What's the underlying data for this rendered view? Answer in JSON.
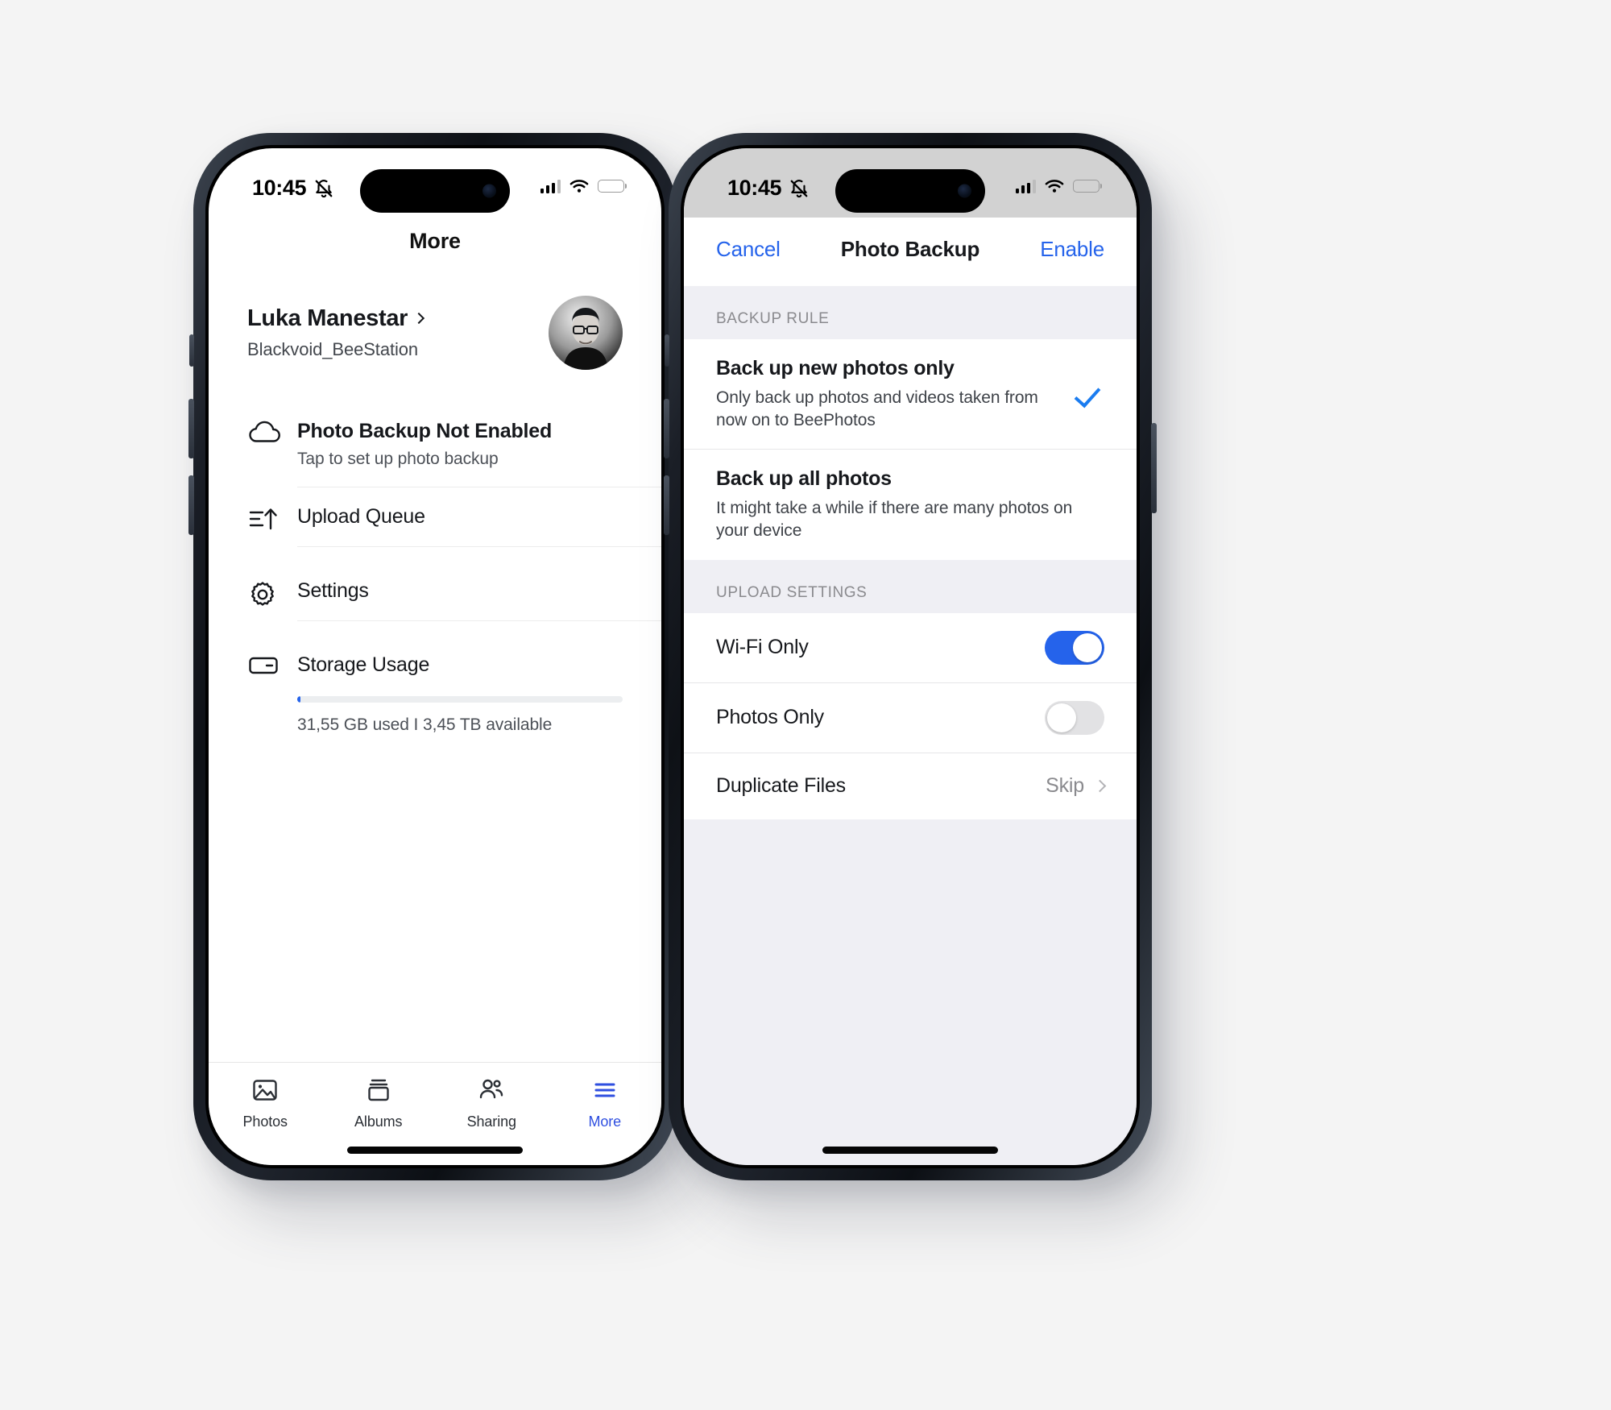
{
  "background_color": "#f4f4f4",
  "accent_color": "#2563eb",
  "left_phone": {
    "status_bar": {
      "time": "10:45",
      "mute_icon": "bell-slash-icon",
      "cellular_icon": "cellular-signal-icon",
      "wifi_icon": "wifi-icon",
      "battery_icon": "battery-icon"
    },
    "nav_title": "More",
    "profile": {
      "name": "Luka Manestar",
      "subtitle": "Blackvoid_BeeStation",
      "chevron_icon": "chevron-right-icon",
      "avatar_icon": "avatar"
    },
    "menu": [
      {
        "icon": "cloud-icon",
        "title": "Photo Backup Not Enabled",
        "subtitle": "Tap to set up photo backup",
        "bold": true
      },
      {
        "icon": "upload-queue-icon",
        "title": "Upload Queue",
        "subtitle": "",
        "bold": false
      },
      {
        "icon": "gear-icon",
        "title": "Settings",
        "subtitle": "",
        "bold": false
      },
      {
        "icon": "hard-drive-icon",
        "title": "Storage Usage",
        "subtitle": "",
        "bold": false
      }
    ],
    "storage": {
      "used_percent": 1,
      "label": "31,55 GB used I 3,45 TB available"
    },
    "tabs": [
      {
        "label": "Photos",
        "icon": "photos-icon",
        "active": false
      },
      {
        "label": "Albums",
        "icon": "albums-icon",
        "active": false
      },
      {
        "label": "Sharing",
        "icon": "sharing-icon",
        "active": false
      },
      {
        "label": "More",
        "icon": "hamburger-menu-icon",
        "active": true
      }
    ]
  },
  "right_phone": {
    "status_bar": {
      "time": "10:45",
      "mute_icon": "bell-slash-icon",
      "cellular_icon": "cellular-signal-icon",
      "wifi_icon": "wifi-icon",
      "battery_icon": "battery-icon"
    },
    "modal_nav": {
      "cancel_label": "Cancel",
      "title": "Photo Backup",
      "enable_label": "Enable"
    },
    "backup_rule": {
      "header": "BACKUP RULE",
      "options": [
        {
          "title": "Back up new photos only",
          "subtitle": "Only back up photos and videos taken from now on to BeePhotos",
          "selected": true
        },
        {
          "title": "Back up all photos",
          "subtitle": "It might take a while if there are many photos on your device",
          "selected": false
        }
      ]
    },
    "upload_settings": {
      "header": "UPLOAD SETTINGS",
      "rows": [
        {
          "label": "Wi-Fi Only",
          "type": "toggle",
          "value": "on"
        },
        {
          "label": "Photos Only",
          "type": "toggle",
          "value": "off"
        },
        {
          "label": "Duplicate Files",
          "type": "disclosure",
          "value": "Skip"
        }
      ]
    }
  }
}
